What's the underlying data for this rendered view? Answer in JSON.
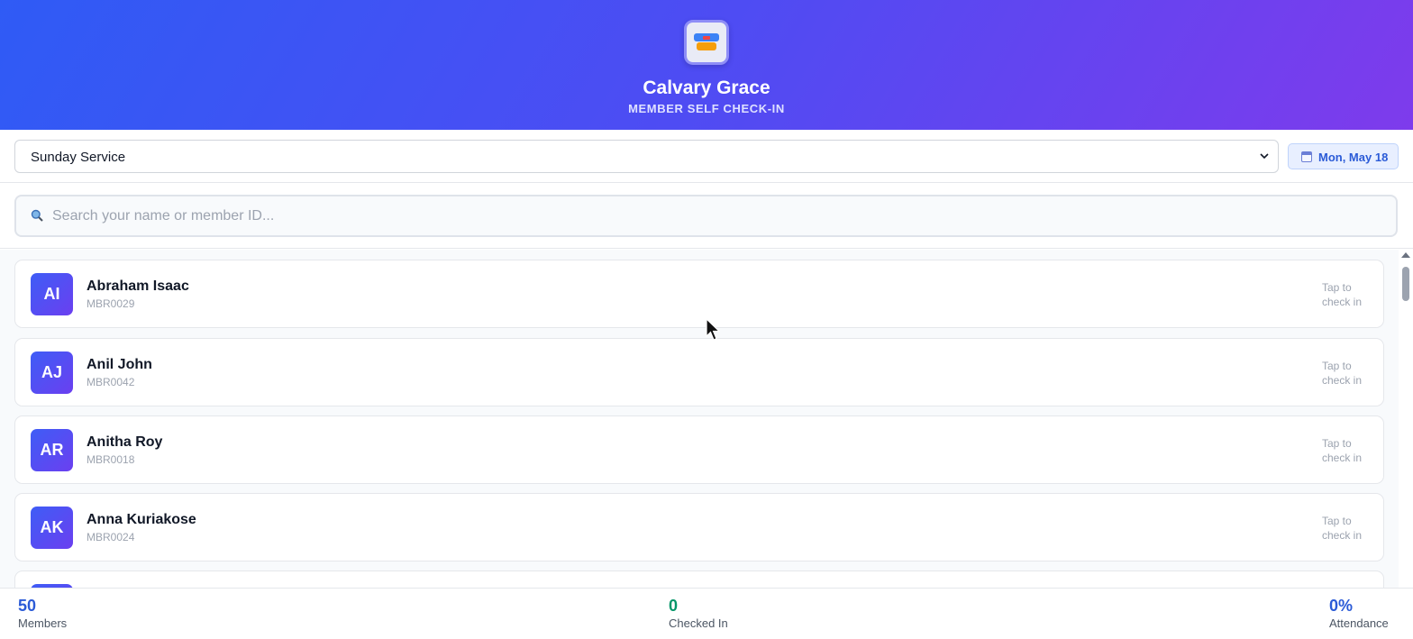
{
  "header": {
    "title": "Calvary Grace",
    "subtitle": "MEMBER SELF CHECK-IN",
    "logo_icon": "church-logo"
  },
  "toolbar": {
    "service_selected": "Sunday Service",
    "date_label": "Mon, May 18"
  },
  "search": {
    "placeholder": "Search your name or member ID...",
    "value": ""
  },
  "members": [
    {
      "initials": "AI",
      "name": "Abraham Isaac",
      "id": "MBR0029",
      "action": "Tap to check in"
    },
    {
      "initials": "AJ",
      "name": "Anil John",
      "id": "MBR0042",
      "action": "Tap to check in"
    },
    {
      "initials": "AR",
      "name": "Anitha Roy",
      "id": "MBR0018",
      "action": "Tap to check in"
    },
    {
      "initials": "AK",
      "name": "Anna Kuriakose",
      "id": "MBR0024",
      "action": "Tap to check in"
    }
  ],
  "footer": {
    "members_count": "50",
    "members_label": "Members",
    "checked_in_count": "0",
    "checked_in_label": "Checked In",
    "attendance_value": "0%",
    "attendance_label": "Attendance"
  },
  "colors": {
    "accent_blue": "#2b5bd7",
    "success_green": "#059669",
    "gradient_start": "#2f5bf5",
    "gradient_end": "#7e3bec"
  }
}
